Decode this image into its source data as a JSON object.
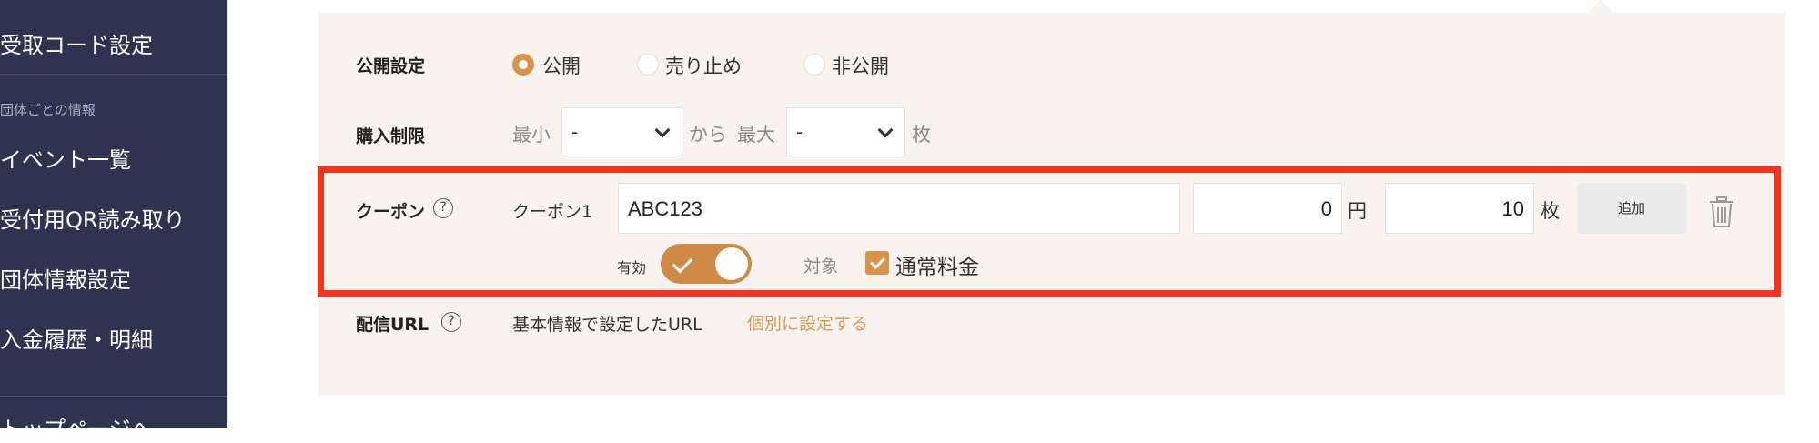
{
  "sidebar": {
    "items": [
      {
        "label": "受取コード設定"
      },
      {
        "label": "イベント一覧"
      },
      {
        "label": "受付用QR読み取り"
      },
      {
        "label": "団体情報設定"
      },
      {
        "label": "入金履歴・明細"
      },
      {
        "label": "トップページへ"
      }
    ],
    "section_label": "団体ごとの情報"
  },
  "form": {
    "visibility": {
      "label": "公開設定",
      "options": [
        "公開",
        "売り止め",
        "非公開"
      ],
      "selected": "公開"
    },
    "purchase_limit": {
      "label": "購入制限",
      "min_label": "最小",
      "min_value": "-",
      "from_label": "から",
      "max_label": "最大",
      "max_value": "-",
      "unit": "枚"
    },
    "coupon": {
      "label": "クーポン",
      "help": "?",
      "name_label": "クーポン1",
      "code": "ABC123",
      "discount": "0",
      "discount_unit": "円",
      "quantity": "10",
      "quantity_unit": "枚",
      "add_button": "追加",
      "enabled_label": "有効",
      "target_label": "対象",
      "target_option": "通常料金"
    },
    "distribution_url": {
      "label": "配信URL",
      "help": "?",
      "value": "基本情報で設定したURL",
      "link": "個別に設定する"
    }
  },
  "colors": {
    "sidebar_bg": "#2e3450",
    "accent": "#d9924a",
    "highlight": "#f4331a",
    "panel_bg": "#f8f3ee"
  }
}
